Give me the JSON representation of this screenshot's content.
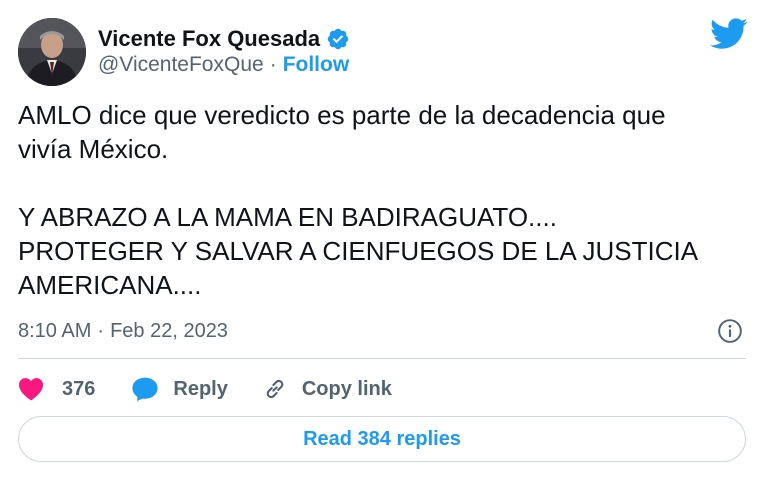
{
  "author": {
    "display_name": "Vicente Fox Quesada",
    "handle": "@VicenteFoxQue",
    "separator": "·",
    "follow_label": "Follow",
    "verified_icon": "verified-badge-icon",
    "avatar_icon": "profile-photo"
  },
  "brand": {
    "logo_icon": "twitter-bird-icon",
    "accent_color": "#1d9bf0"
  },
  "tweet": {
    "paragraph_1": "AMLO dice que veredicto es parte de la decadencia que\nvivía México.",
    "paragraph_2": "Y ABRAZO A LA MAMA EN BADIRAGUATO....\nPROTEGER Y SALVAR A CIENFUEGOS DE LA JUSTICIA\nAMERICANA...."
  },
  "meta": {
    "time": "8:10 AM",
    "separator": "·",
    "date": "Feb 22, 2023",
    "info_icon": "info-icon"
  },
  "actions": {
    "like_count": "376",
    "like_color": "#f91880",
    "reply_label": "Reply",
    "copy_link_label": "Copy link"
  },
  "replies_button": {
    "label": "Read 384 replies"
  }
}
